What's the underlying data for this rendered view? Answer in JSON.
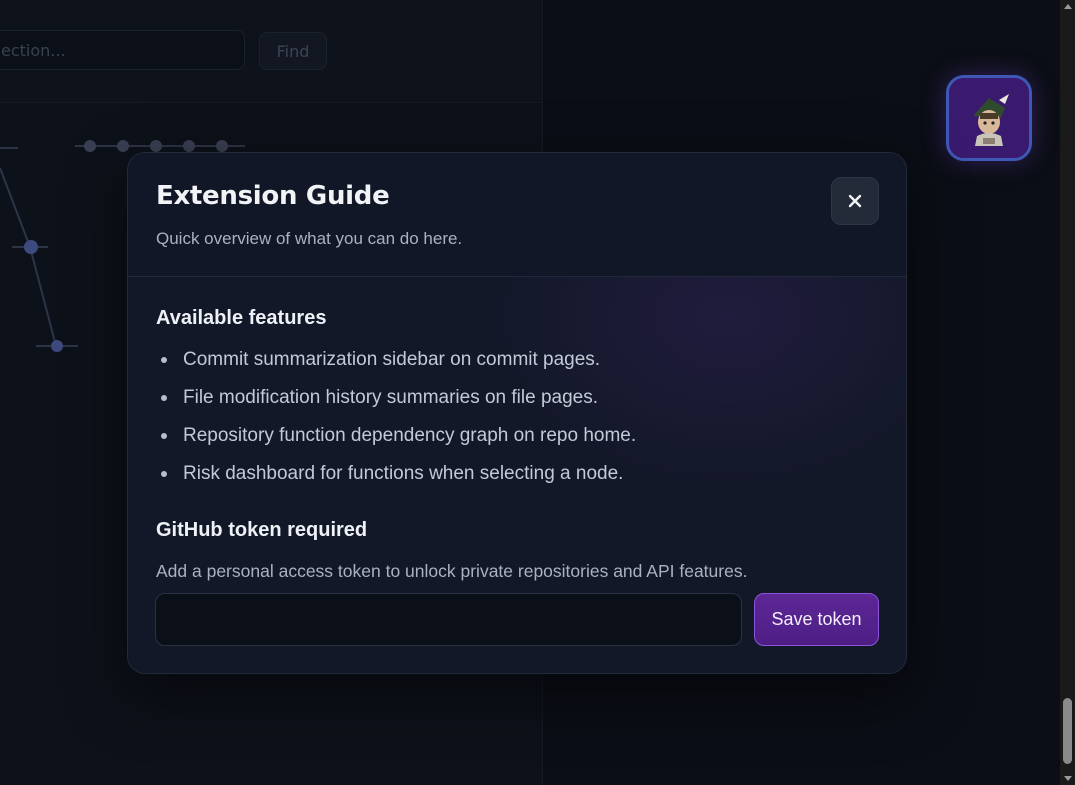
{
  "background": {
    "search_placeholder": "ection...",
    "find_button_label": "Find"
  },
  "modal": {
    "title": "Extension Guide",
    "subtitle": "Quick overview of what you can do here.",
    "close_icon": "close-icon",
    "features_heading": "Available features",
    "features": [
      "Commit summarization sidebar on commit pages.",
      "File modification history summaries on file pages.",
      "Repository function dependency graph on repo home.",
      "Risk dashboard for functions when selecting a node."
    ],
    "token_heading": "GitHub token required",
    "token_description": "Add a personal access token to unlock private repositories and API features.",
    "token_input_value": "",
    "save_button_label": "Save token"
  },
  "colors": {
    "accent": "#5d2796",
    "accent_border": "#8a55d8",
    "modal_bg": "#111726",
    "page_bg": "#0b0e16"
  }
}
